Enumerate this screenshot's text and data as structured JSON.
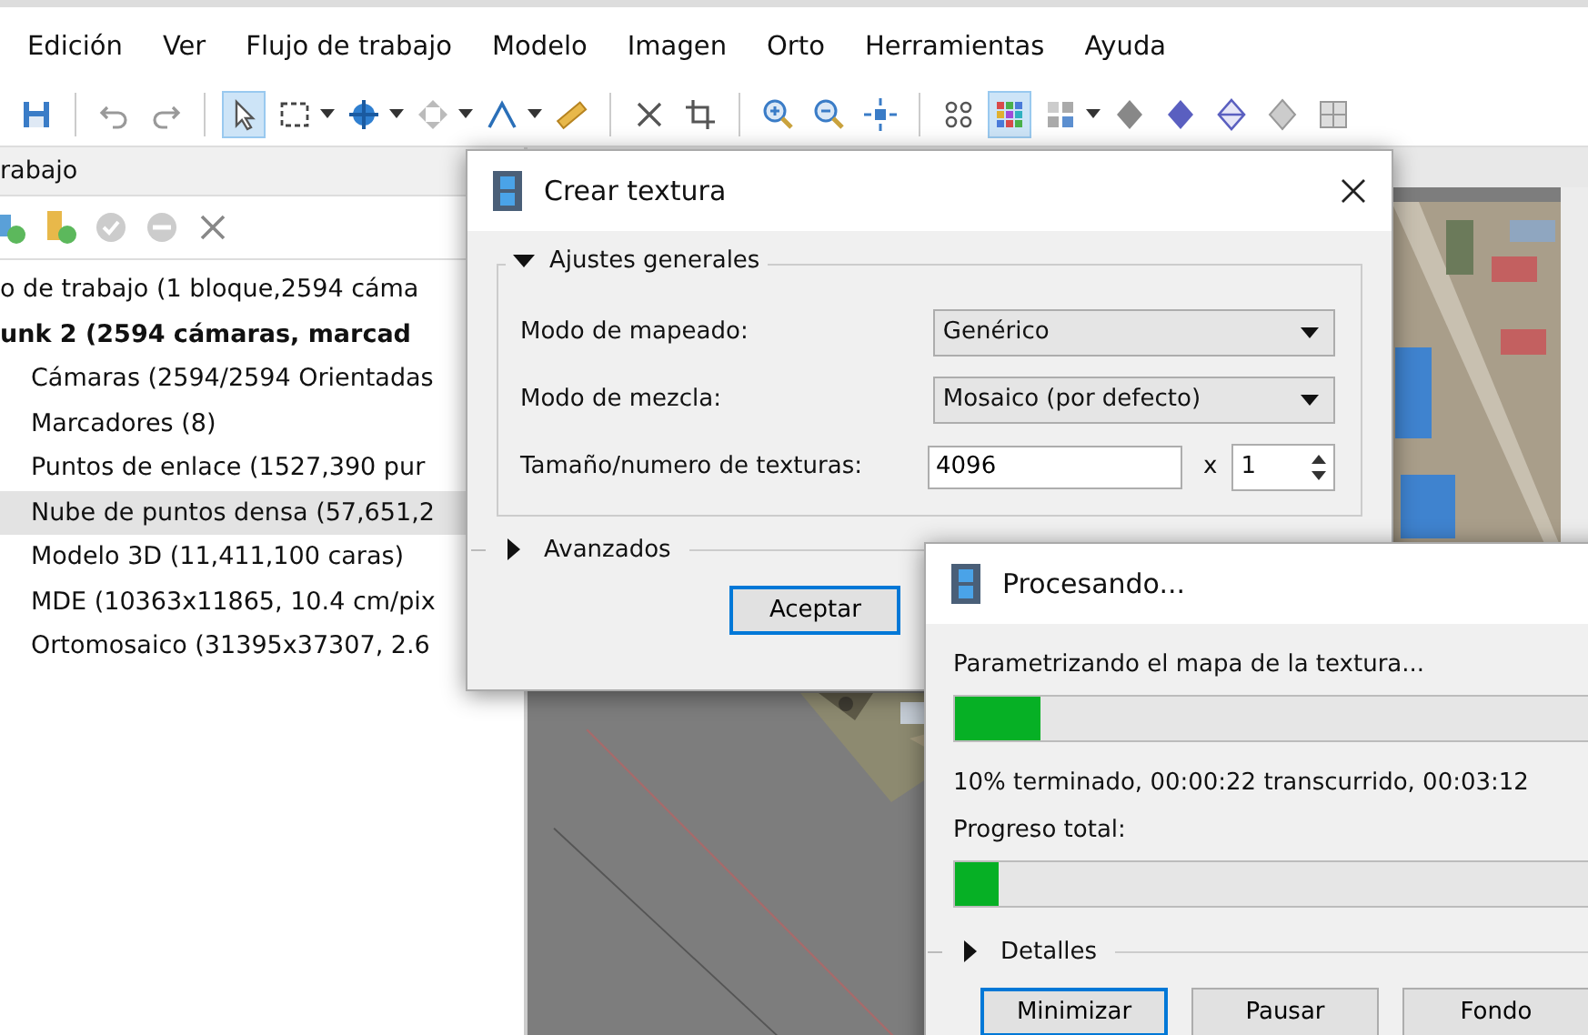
{
  "menu": [
    "Edición",
    "Ver",
    "Flujo de trabajo",
    "Modelo",
    "Imagen",
    "Orto",
    "Herramientas",
    "Ayuda"
  ],
  "toolbar": [
    {
      "items": [
        {
          "kind": "save",
          "selected": false,
          "menu": false
        }
      ]
    },
    {
      "items": [
        {
          "kind": "undo",
          "selected": false,
          "menu": false
        },
        {
          "kind": "redo",
          "selected": false,
          "menu": false
        }
      ]
    },
    {
      "items": [
        {
          "kind": "pointer",
          "selected": true,
          "menu": false
        },
        {
          "kind": "rect-select",
          "selected": false,
          "menu": true
        },
        {
          "kind": "navigate",
          "selected": false,
          "menu": true
        },
        {
          "kind": "move",
          "selected": false,
          "menu": true
        },
        {
          "kind": "polyline",
          "selected": false,
          "menu": true
        },
        {
          "kind": "ruler",
          "selected": false,
          "menu": false
        }
      ]
    },
    {
      "items": [
        {
          "kind": "delete",
          "selected": false,
          "menu": false
        },
        {
          "kind": "crop",
          "selected": false,
          "menu": false
        }
      ]
    },
    {
      "items": [
        {
          "kind": "zoom-in",
          "selected": false,
          "menu": false
        },
        {
          "kind": "zoom-out",
          "selected": false,
          "menu": false
        },
        {
          "kind": "fit",
          "selected": false,
          "menu": false
        }
      ]
    },
    {
      "items": [
        {
          "kind": "dots",
          "selected": false,
          "menu": false
        },
        {
          "kind": "color-grid",
          "selected": true,
          "menu": false
        },
        {
          "kind": "tile-grid",
          "selected": false,
          "menu": true
        },
        {
          "kind": "solid",
          "selected": false,
          "menu": false
        },
        {
          "kind": "solid-blue",
          "selected": false,
          "menu": false
        },
        {
          "kind": "wire",
          "selected": false,
          "menu": false
        },
        {
          "kind": "shaded",
          "selected": false,
          "menu": false
        },
        {
          "kind": "box",
          "selected": false,
          "menu": false
        }
      ]
    }
  ],
  "workspace": {
    "title": "rabajo",
    "tools": [
      {
        "kind": "add-chunk"
      },
      {
        "kind": "add-ruler"
      },
      {
        "kind": "check"
      },
      {
        "kind": "minus"
      },
      {
        "kind": "remove"
      }
    ],
    "tree": [
      {
        "label": "o de trabajo (1 bloque,2594 cáma",
        "children": [
          {
            "label": "unk 2 (2594 cámaras,    marcad",
            "active": true,
            "children": [
              {
                "label": "Cámaras (2594/2594 Orientadas",
                "selected": false
              },
              {
                "label": "Marcadores (8)",
                "selected": false
              },
              {
                "label": "Puntos de enlace (1527,390 pur",
                "selected": false
              },
              {
                "label": "Nube de puntos densa (57,651,2",
                "selected": true
              },
              {
                "label": "Modelo 3D (11,411,100 caras)",
                "selected": false
              },
              {
                "label": "MDE (10363x11865, 10.4 cm/pix",
                "selected": false
              },
              {
                "label": "Ortomosaico (31395x37307, 2.6",
                "selected": false
              }
            ]
          }
        ]
      }
    ]
  },
  "texture_dialog": {
    "title": "Crear textura",
    "general": {
      "label": "Ajustes generales",
      "expanded": true
    },
    "fields": [
      {
        "kind": "combo",
        "label": "Modo de mapeado:",
        "value": "Genérico"
      },
      {
        "kind": "combo",
        "label": "Modo de mezcla:",
        "value": "Mosaico (por defecto)"
      },
      {
        "kind": "size",
        "label": "Tamaño/numero de texturas:",
        "value": "4096",
        "times": "x",
        "count": "1"
      }
    ],
    "advanced": {
      "label": "Avanzados",
      "expanded": false
    },
    "button": "Aceptar"
  },
  "progress_dialog": {
    "title": "Procesando...",
    "task": "Parametrizando el mapa de la textura...",
    "level": 0.1,
    "status": "10% terminado, 00:00:22 transcurrido, 00:03:12",
    "total": {
      "label": "Progreso total:",
      "level": 0.05
    },
    "details": {
      "label": "Detalles",
      "expanded": false
    },
    "buttons": [
      "Minimizar",
      "Pausar",
      "Fondo"
    ]
  }
}
